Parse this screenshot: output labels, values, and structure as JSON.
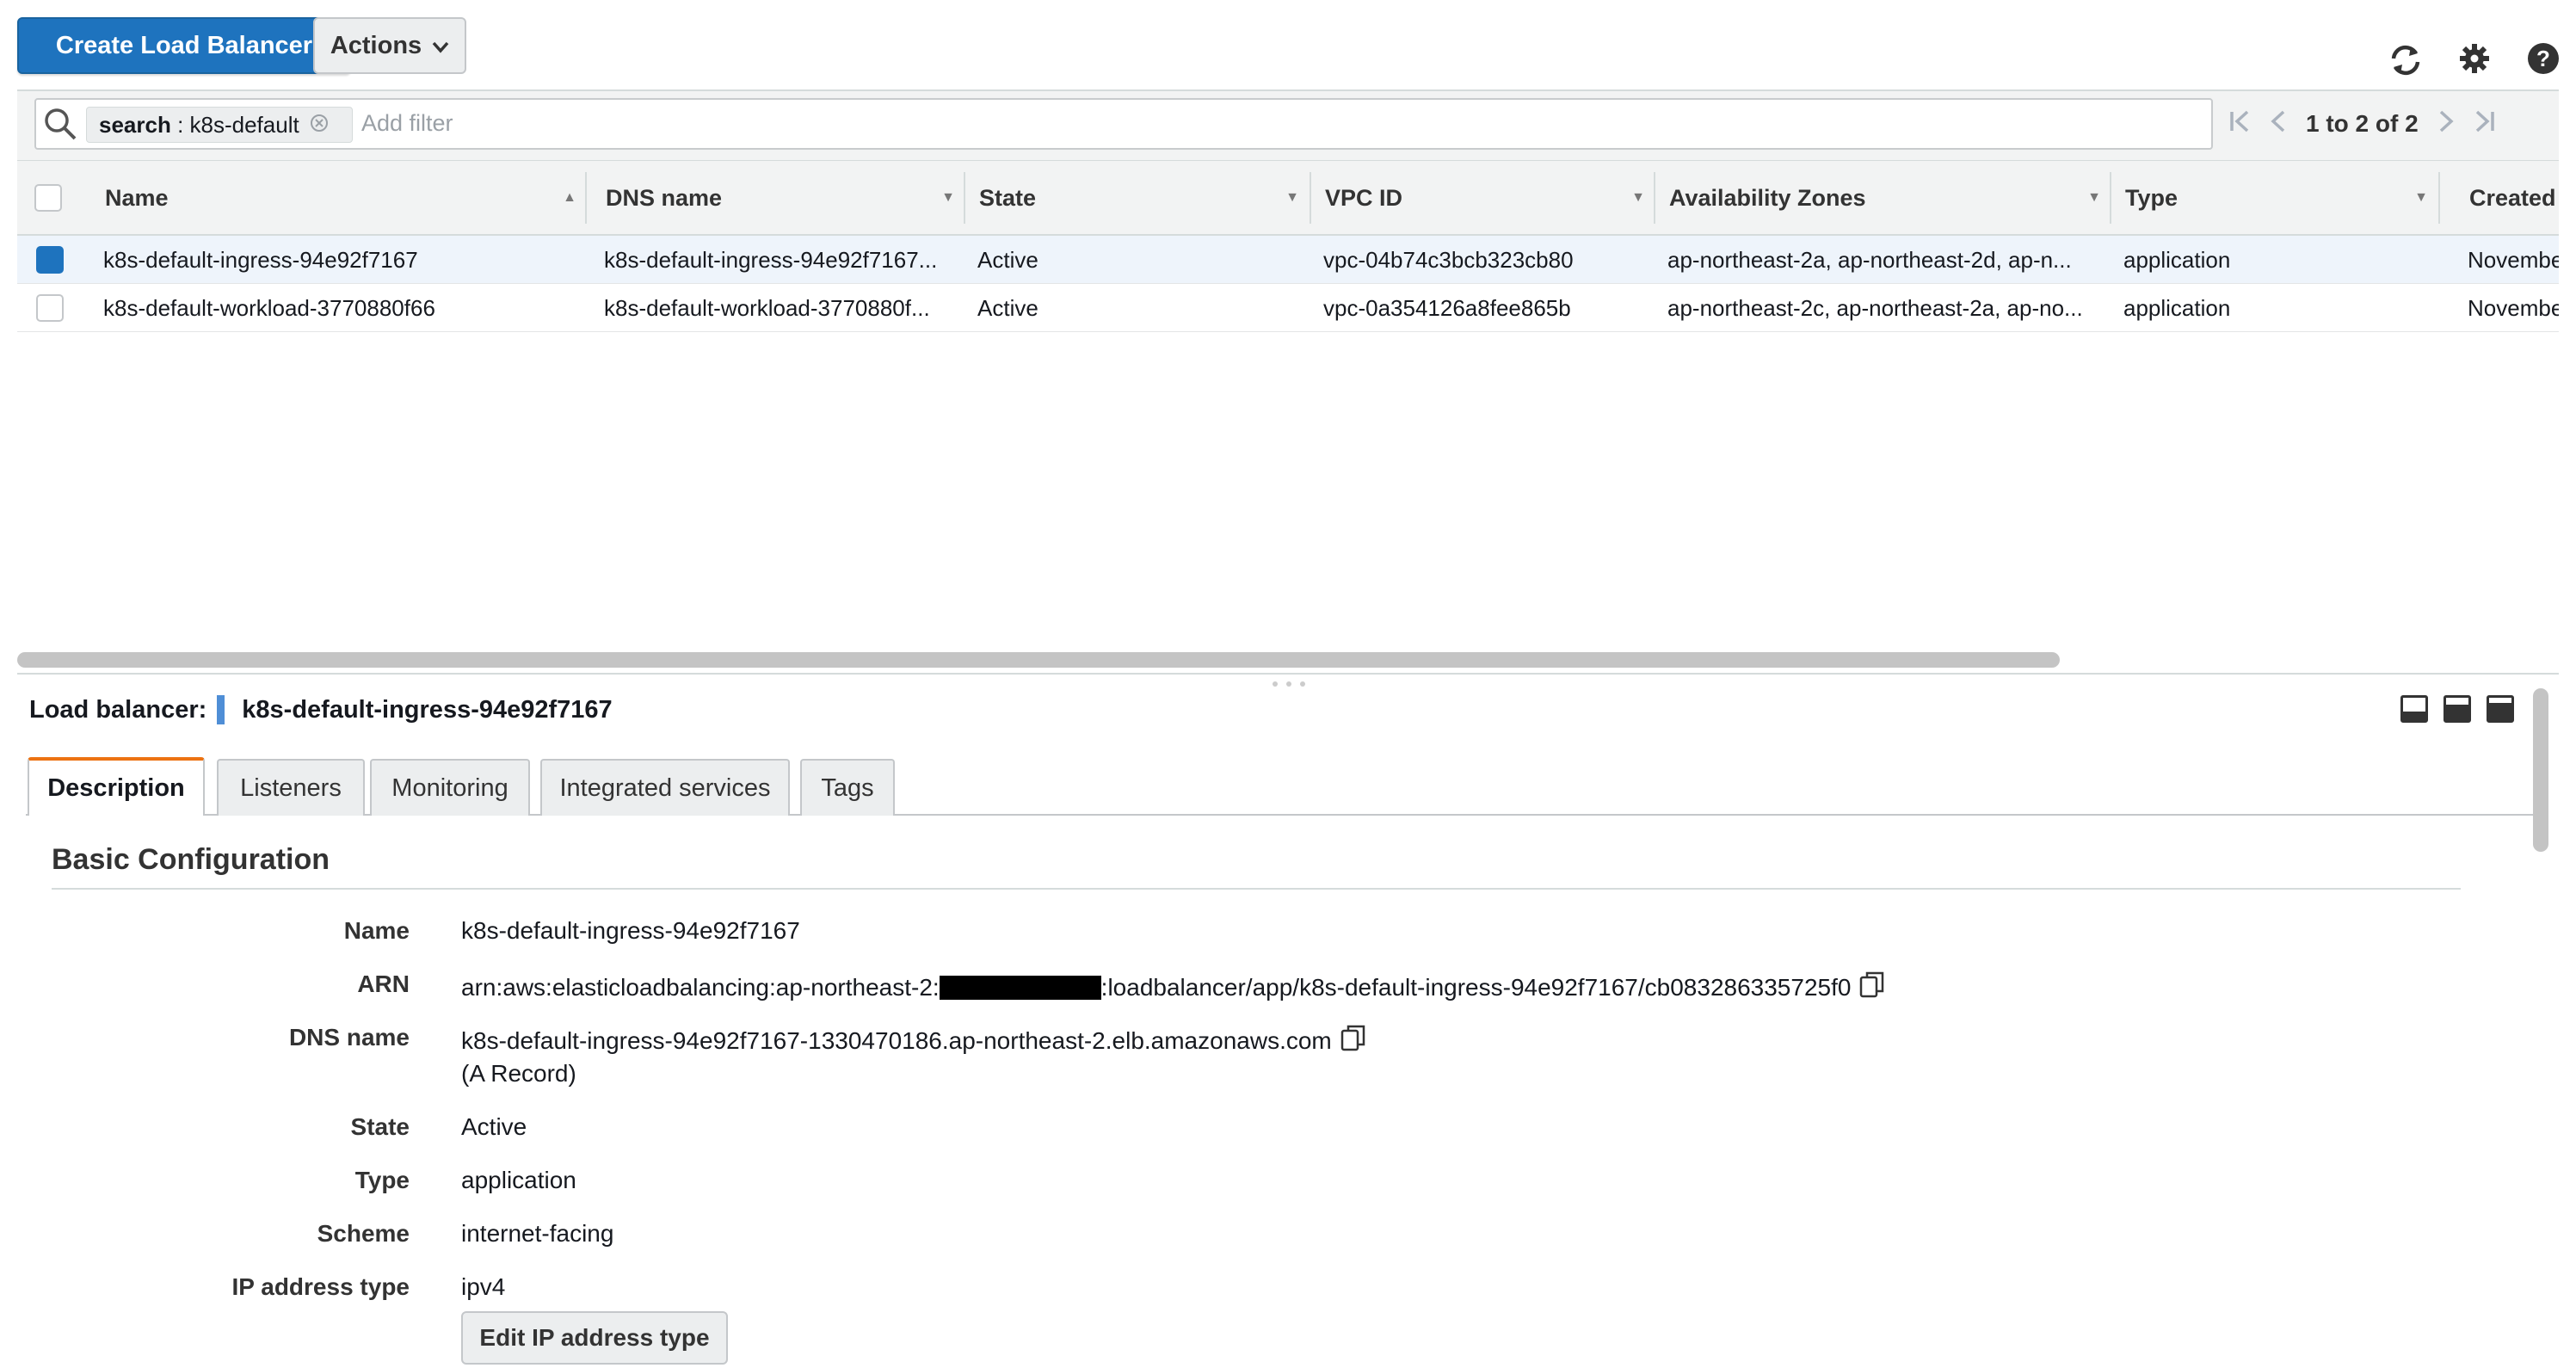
{
  "toolbar": {
    "create_label": "Create Load Balancer",
    "actions_label": "Actions",
    "icons": [
      "refresh-icon",
      "gear-icon",
      "help-icon"
    ]
  },
  "filter": {
    "token_key": "search",
    "token_value": "k8s-default",
    "placeholder": "Add filter",
    "pagination": "1 to 2 of 2"
  },
  "table": {
    "columns": [
      "Name",
      "DNS name",
      "State",
      "VPC ID",
      "Availability Zones",
      "Type",
      "Created At"
    ],
    "rows": [
      {
        "selected": true,
        "name": "k8s-default-ingress-94e92f7167",
        "dns": "k8s-default-ingress-94e92f7167...",
        "state": "Active",
        "vpc": "vpc-04b74c3bcb323cb80",
        "azs": "ap-northeast-2a, ap-northeast-2d, ap-n...",
        "type": "application",
        "created": "November"
      },
      {
        "selected": false,
        "name": "k8s-default-workload-3770880f66",
        "dns": "k8s-default-workload-3770880f...",
        "state": "Active",
        "vpc": "vpc-0a354126a8fee865b",
        "azs": "ap-northeast-2c, ap-northeast-2a, ap-no...",
        "type": "application",
        "created": "November"
      }
    ]
  },
  "detail": {
    "label": "Load balancer:",
    "name": "k8s-default-ingress-94e92f7167",
    "tabs": [
      "Description",
      "Listeners",
      "Monitoring",
      "Integrated services",
      "Tags"
    ],
    "section_title": "Basic Configuration",
    "fields": {
      "name_label": "Name",
      "name_value": "k8s-default-ingress-94e92f7167",
      "arn_label": "ARN",
      "arn_prefix": "arn:aws:elasticloadbalancing:ap-northeast-2:",
      "arn_suffix": ":loadbalancer/app/k8s-default-ingress-94e92f7167/cb083286335725f0",
      "dns_label": "DNS name",
      "dns_value": "k8s-default-ingress-94e92f7167-1330470186.ap-northeast-2.elb.amazonaws.com",
      "dns_record": "(A Record)",
      "state_label": "State",
      "state_value": "Active",
      "type_label": "Type",
      "type_value": "application",
      "scheme_label": "Scheme",
      "scheme_value": "internet-facing",
      "ip_label": "IP address type",
      "ip_value": "ipv4",
      "edit_ip_button": "Edit IP address type"
    }
  },
  "colors": {
    "primary_button": "#1e73be",
    "active_tab_accent": "#ec7211",
    "selected_row": "#eef4fb"
  }
}
